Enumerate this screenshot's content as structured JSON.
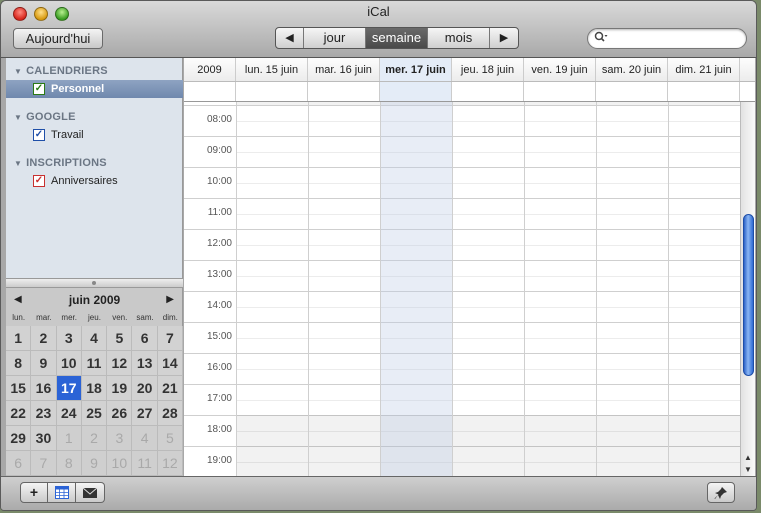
{
  "window": {
    "title": "iCal"
  },
  "toolbar": {
    "today_label": "Aujourd'hui",
    "prev_arrow": "◀",
    "next_arrow": "▶",
    "views": [
      "jour",
      "semaine",
      "mois"
    ],
    "active_view": "semaine",
    "search_placeholder": ""
  },
  "sidebar": {
    "sections": [
      {
        "title": "CALENDRIERS",
        "items": [
          {
            "label": "Personnel",
            "checked": true,
            "color": "#3a9e22",
            "selected": true
          }
        ]
      },
      {
        "title": "GOOGLE",
        "items": [
          {
            "label": "Travail",
            "checked": true,
            "color": "#1f4fa8",
            "selected": false
          }
        ]
      },
      {
        "title": "INSCRIPTIONS",
        "items": [
          {
            "label": "Anniversaires",
            "checked": true,
            "color": "#c83030",
            "selected": false
          }
        ]
      }
    ]
  },
  "minical": {
    "month_label": "juin 2009",
    "prev_arrow": "◀",
    "next_arrow": "▶",
    "weekdays": [
      "lun.",
      "mar.",
      "mer.",
      "jeu.",
      "ven.",
      "sam.",
      "dim."
    ],
    "days": [
      [
        "1",
        "2",
        "3",
        "4",
        "5",
        "6",
        "7"
      ],
      [
        "8",
        "9",
        "10",
        "11",
        "12",
        "13",
        "14"
      ],
      [
        "15",
        "16",
        "17",
        "18",
        "19",
        "20",
        "21"
      ],
      [
        "22",
        "23",
        "24",
        "25",
        "26",
        "27",
        "28"
      ],
      [
        "29",
        "30",
        "1",
        "2",
        "3",
        "4",
        "5"
      ],
      [
        "6",
        "7",
        "8",
        "9",
        "10",
        "11",
        "12"
      ]
    ],
    "today": "17"
  },
  "week": {
    "year_label": "2009",
    "days": [
      "lun. 15 juin",
      "mar. 16 juin",
      "mer. 17 juin",
      "jeu. 18 juin",
      "ven. 19 juin",
      "sam. 20 juin",
      "dim. 21 juin"
    ],
    "today_index": 2,
    "hours": [
      "08:00",
      "09:00",
      "10:00",
      "11:00",
      "12:00",
      "13:00",
      "14:00",
      "15:00",
      "16:00",
      "17:00",
      "18:00",
      "19:00"
    ]
  },
  "bottom": {
    "add": "+",
    "mail": "✉",
    "pin": "📌"
  },
  "colors": {
    "accent": "#2b63d6",
    "today_column": "#e4ecf7",
    "selected_row": "#7c93b6"
  }
}
